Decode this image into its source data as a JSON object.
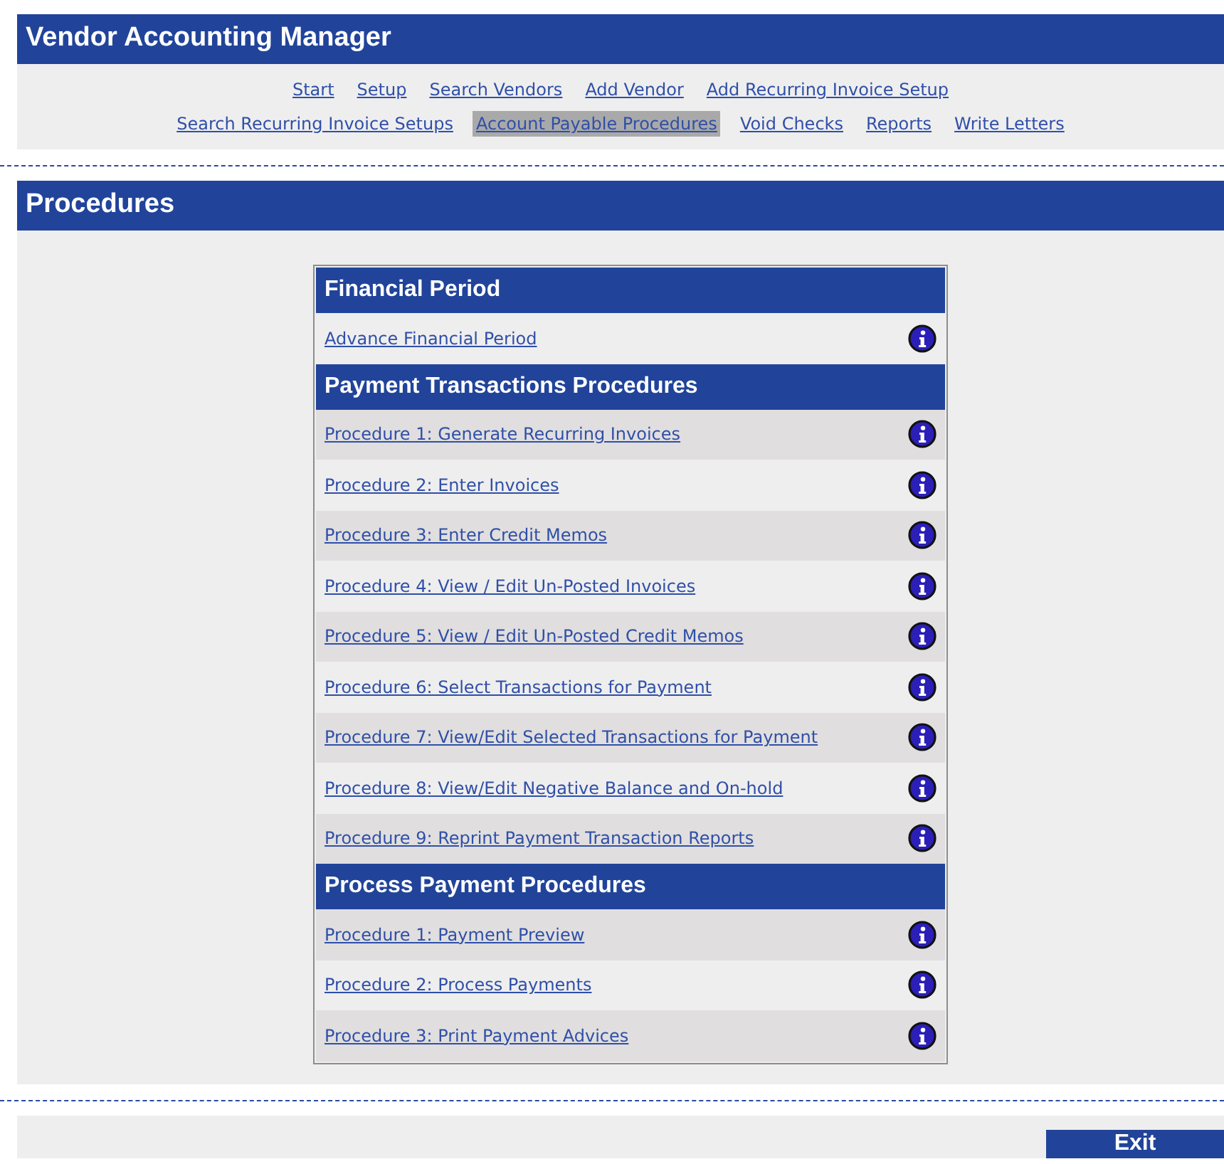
{
  "app_title": "Vendor Accounting Manager",
  "nav_rows": [
    [
      {
        "label": "Start",
        "selected": false
      },
      {
        "label": "Setup",
        "selected": false
      },
      {
        "label": "Search Vendors",
        "selected": false
      },
      {
        "label": "Add Vendor",
        "selected": false
      },
      {
        "label": "Add Recurring Invoice Setup",
        "selected": false
      }
    ],
    [
      {
        "label": "Search Recurring Invoice Setups",
        "selected": false
      },
      {
        "label": "Account Payable Procedures",
        "selected": true
      },
      {
        "label": "Void Checks",
        "selected": false
      },
      {
        "label": "Reports",
        "selected": false
      },
      {
        "label": "Write Letters",
        "selected": false
      }
    ]
  ],
  "page_title": "Procedures",
  "sections": [
    {
      "title": "Financial Period",
      "items": [
        "Advance Financial Period"
      ]
    },
    {
      "title": "Payment Transactions Procedures",
      "items": [
        "Procedure 1: Generate Recurring Invoices",
        "Procedure 2: Enter Invoices",
        "Procedure 3: Enter Credit Memos",
        "Procedure 4: View / Edit Un-Posted Invoices",
        "Procedure 5: View / Edit Un-Posted Credit Memos",
        "Procedure 6: Select Transactions for Payment",
        "Procedure 7: View/Edit Selected Transactions for Payment",
        "Procedure 8: View/Edit Negative Balance and On-hold",
        "Procedure 9: Reprint Payment Transaction Reports"
      ]
    },
    {
      "title": "Process Payment Procedures",
      "items": [
        "Procedure 1: Payment Preview",
        "Procedure 2: Process Payments",
        "Procedure 3: Print Payment Advices"
      ]
    }
  ],
  "exit_button": "Exit"
}
